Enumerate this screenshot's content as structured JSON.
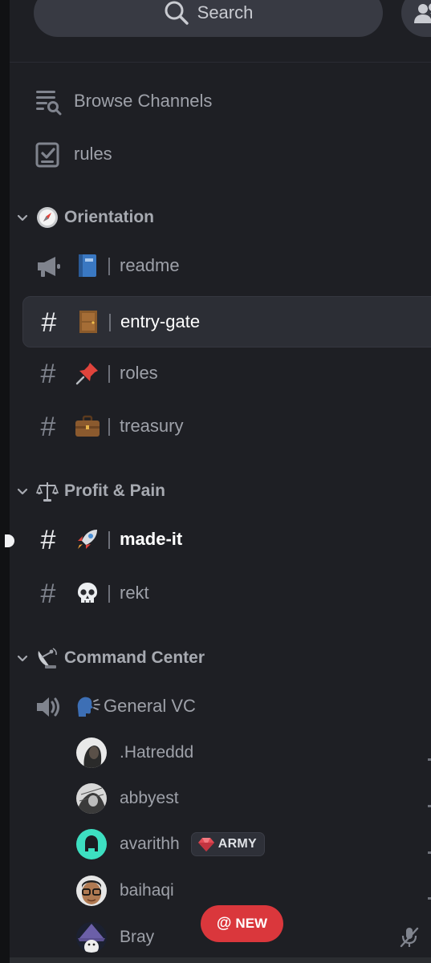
{
  "search": {
    "label": "Search"
  },
  "top_channels": [
    {
      "name": "Browse Channels",
      "icon": "browse-channels-icon"
    },
    {
      "name": "rules",
      "icon": "rules-checklist-icon"
    }
  ],
  "categories": [
    {
      "name": "Orientation",
      "emoji": "compass",
      "channels": [
        {
          "name": "readme",
          "emoji": "blue-book",
          "type": "announcement"
        },
        {
          "name": "entry-gate",
          "emoji": "door",
          "type": "text",
          "selected": true
        },
        {
          "name": "roles",
          "emoji": "pushpin",
          "type": "text"
        },
        {
          "name": "treasury",
          "emoji": "briefcase",
          "type": "text"
        }
      ]
    },
    {
      "name": "Profit & Pain",
      "emoji": "scales",
      "channels": [
        {
          "name": "made-it",
          "emoji": "rocket",
          "type": "text",
          "unread": true
        },
        {
          "name": "rekt",
          "emoji": "skull",
          "type": "text"
        }
      ]
    },
    {
      "name": "Command Center",
      "emoji": "satellite-dish",
      "channels": [
        {
          "name": "General VC",
          "emoji": "speaking-head",
          "type": "voice"
        }
      ]
    }
  ],
  "voice_users": [
    {
      "name": ".Hatreddd"
    },
    {
      "name": "abbyest"
    },
    {
      "name": "avarithh",
      "tag": "ARMY"
    },
    {
      "name": "baihaqi"
    },
    {
      "name": "Bray"
    }
  ],
  "new_badge": {
    "at": "@",
    "label": "NEW"
  },
  "colors": {
    "background": "#1e1f24",
    "selected_row": "#2c2e35",
    "new_badge": "#da373c",
    "muted_text": "#9ea1a9"
  }
}
